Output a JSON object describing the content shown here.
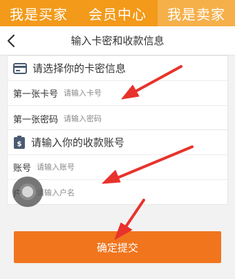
{
  "top_tabs": [
    "我是买家",
    "会员中心",
    "我是卖家"
  ],
  "header": {
    "title": "输入卡密和收款信息"
  },
  "card_section": {
    "title": "请选择你的卡密信息",
    "card_no_label": "第一张卡号",
    "card_no_placeholder": "请输入卡号",
    "card_pwd_label": "第一张密码",
    "card_pwd_placeholder": "请输入密码"
  },
  "payee_section": {
    "title": "请输入你的收款账号",
    "account_label": "账号",
    "account_placeholder": "请输入账号",
    "name_label": "户名",
    "name_placeholder": "请输入户名"
  },
  "submit_label": "确定提交",
  "colors": {
    "accent": "#f39a1a",
    "button": "#f0751d",
    "annotation": "#e8322c"
  },
  "icons": [
    "back-arrow-icon",
    "card-icon",
    "money-bag-icon",
    "assistive-touch-icon"
  ]
}
